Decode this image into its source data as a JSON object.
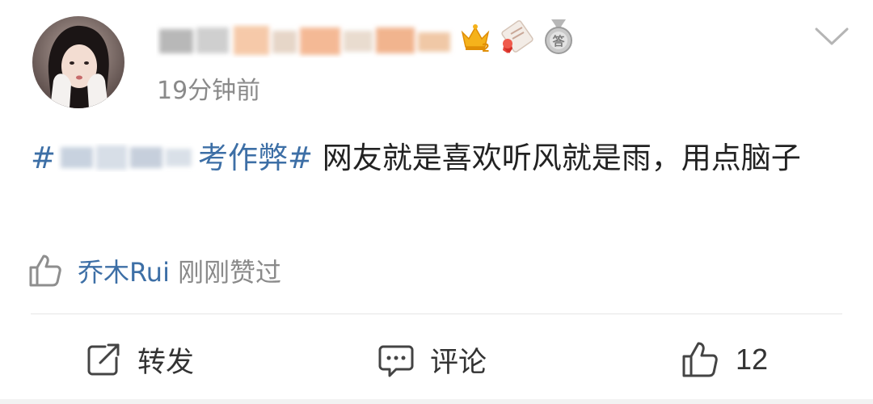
{
  "post": {
    "time": "19分钟前",
    "text": {
      "topic_prefix": "#",
      "topic_suffix": "考作弊#",
      "body": " 网友就是喜欢听风就是雨，用点脑子"
    }
  },
  "badges": [
    "crown-icon",
    "certificate-icon",
    "answer-medal-icon"
  ],
  "liked_by": {
    "user": "乔木Rui",
    "text": "刚刚赞过"
  },
  "actions": {
    "repost_label": "转发",
    "comment_label": "评论",
    "like_count": "12"
  },
  "colors": {
    "link": "#3d6fa6",
    "text": "#222222",
    "muted": "#8a8a8a",
    "divider": "#e6e6e6"
  }
}
